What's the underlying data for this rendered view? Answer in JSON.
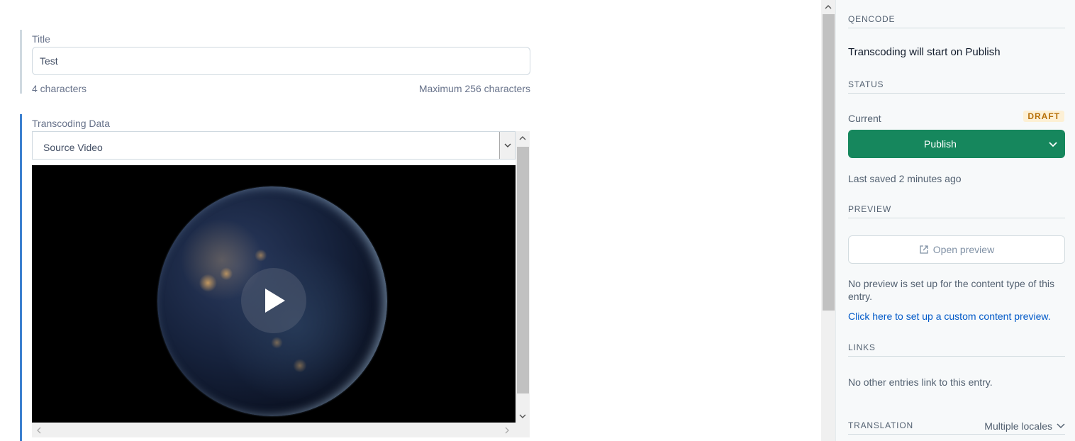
{
  "title_field": {
    "label": "Title",
    "value": "Test",
    "char_count": "4 characters",
    "max_chars": "Maximum 256 characters"
  },
  "transcoding_field": {
    "label": "Transcoding Data",
    "select_value": "Source Video"
  },
  "sidebar": {
    "qencode": {
      "heading": "QENCODE",
      "text": "Transcoding will start on Publish"
    },
    "status": {
      "heading": "STATUS",
      "current_label": "Current",
      "badge": "DRAFT",
      "publish_label": "Publish",
      "last_saved": "Last saved 2 minutes ago"
    },
    "preview": {
      "heading": "PREVIEW",
      "button_label": "Open preview",
      "note": "No preview is set up for the content type of this entry.",
      "link": "Click here to set up a custom content preview."
    },
    "links": {
      "heading": "LINKS",
      "text": "No other entries link to this entry."
    },
    "translation": {
      "heading": "TRANSLATION",
      "value": "Multiple locales"
    }
  },
  "colors": {
    "accent": "#3c80cf",
    "publish": "#16875d",
    "draft_bg": "#fdf0d5",
    "draft_text": "#b7700a",
    "link": "#0059c8"
  }
}
